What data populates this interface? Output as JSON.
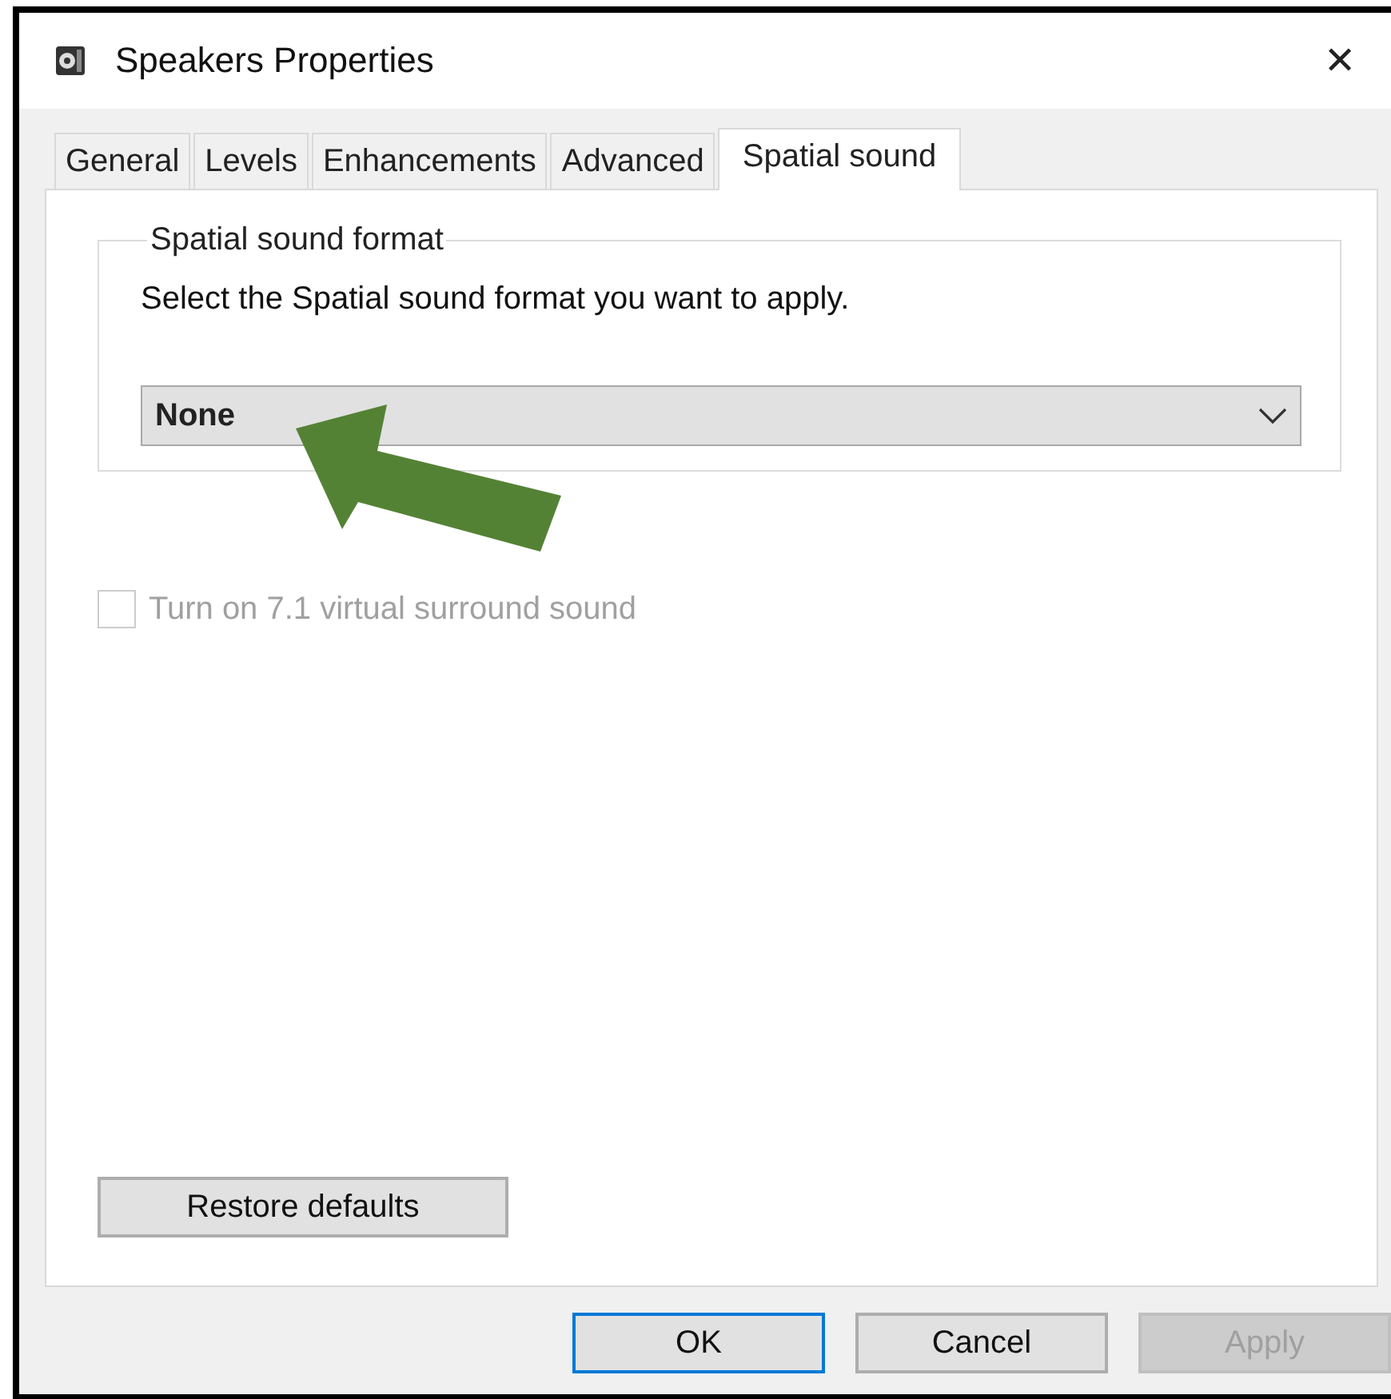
{
  "window": {
    "title": "Speakers Properties",
    "close": "✕"
  },
  "tabs": [
    {
      "label": "General",
      "selected": false
    },
    {
      "label": "Levels",
      "selected": false
    },
    {
      "label": "Enhancements",
      "selected": false
    },
    {
      "label": "Advanced",
      "selected": false
    },
    {
      "label": "Spatial sound",
      "selected": true
    }
  ],
  "group": {
    "title": "Spatial sound format",
    "instruction": "Select the Spatial sound format you want to apply.",
    "format": {
      "value": "None"
    }
  },
  "surround": {
    "label": "Turn on 7.1 virtual surround sound",
    "checked": false,
    "disabled": true
  },
  "restore_button": "Restore defaults",
  "buttons": [
    {
      "label": "OK",
      "default": true,
      "disabled": false
    },
    {
      "label": "Cancel",
      "default": false,
      "disabled": false
    },
    {
      "label": "Apply",
      "default": false,
      "disabled": true
    }
  ]
}
